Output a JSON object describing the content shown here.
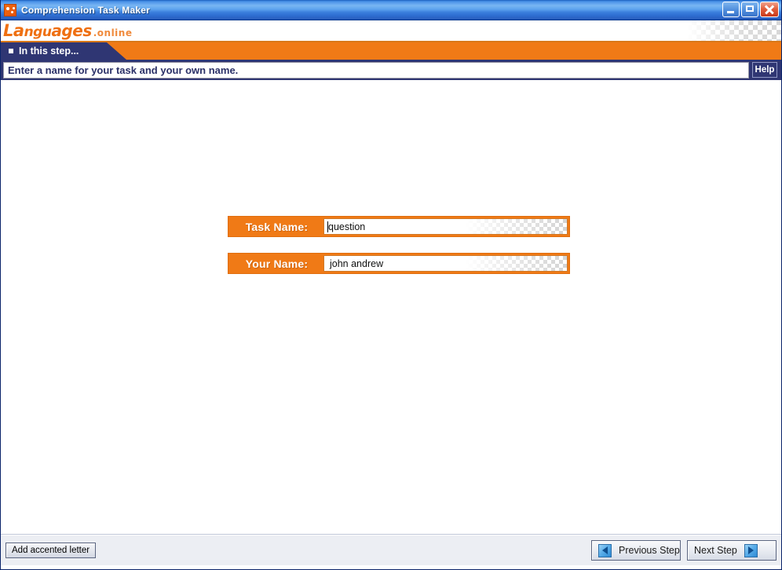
{
  "window": {
    "title": "Comprehension Task Maker",
    "icon": "app-icon",
    "buttons": {
      "minimize": "minimize-icon",
      "maximize": "maximize-icon",
      "close": "close-icon"
    }
  },
  "branding": {
    "logo_main_1": "La",
    "logo_main_2": "ngu",
    "logo_main_3": "ages",
    "logo_sub": ".online",
    "accent_orange": "#f07a16",
    "accent_navy": "#2f3673"
  },
  "step_banner": {
    "label": "In this step..."
  },
  "instruction": {
    "text": "Enter a name for your task and your own name.",
    "help_label": "Help"
  },
  "form": {
    "fields": [
      {
        "label": "Task Name:",
        "value": "question",
        "has_caret": true,
        "placeholder": ""
      },
      {
        "label": "Your Name:",
        "value": "john andrew",
        "has_caret": false,
        "placeholder": ""
      }
    ]
  },
  "footer": {
    "accent_button": "Add accented letter",
    "previous_label": "Previous Step",
    "next_label": "Next Step"
  }
}
